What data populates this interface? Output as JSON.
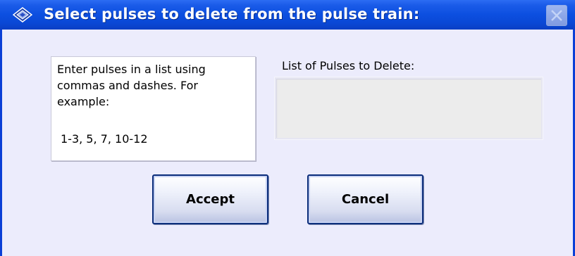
{
  "window": {
    "title": "Select pulses to delete from the pulse train:",
    "icon": "app-diamond-icon",
    "close_icon": "close-icon"
  },
  "instructions": {
    "text": "Enter pulses in a list using\ncommas and dashes.  For\nexample:",
    "example": "1-3, 5, 7, 10-12"
  },
  "pulse_list": {
    "label": "List of Pulses to Delete:",
    "value": ""
  },
  "buttons": {
    "accept": "Accept",
    "cancel": "Cancel"
  },
  "colors": {
    "titlebar": "#0c4fe0",
    "window_background": "#ececfc",
    "border": "#0b3fd6"
  }
}
